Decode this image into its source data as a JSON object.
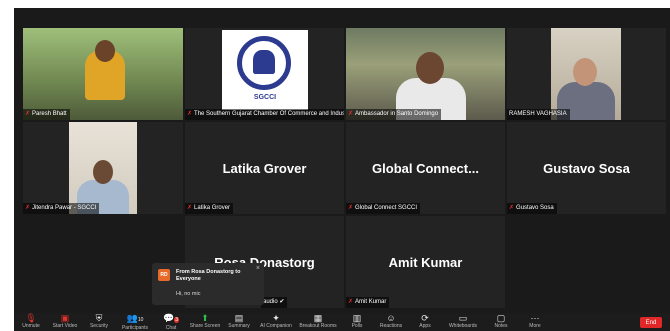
{
  "tiles": [
    {
      "label": "Paresh Bhatt"
    },
    {
      "label": "The Southern Gujarat Chamber Of Commerce and Industry",
      "logo_text": "SGCCI"
    },
    {
      "label": "Ambassador in Santo Domingo"
    },
    {
      "label": "RAMESH VAGHASIA"
    },
    {
      "label": "Jitendra Pawar - SGCCI"
    },
    {
      "label": "Latika Grover",
      "display": "Latika Grover"
    },
    {
      "label": "Global Connect SGCCI",
      "display": "Global  Connect..."
    },
    {
      "label": "Gustavo Sosa",
      "display": "Gustavo Sosa"
    },
    {
      "label": "audio ✔",
      "display": "Rosa Donastorg"
    },
    {
      "label": "Amit Kumar",
      "display": "Amit Kumar"
    }
  ],
  "chat": {
    "avatar": "RD",
    "from": "From Rosa Donastorg to Everyone",
    "message": "Hi, no mic",
    "close_icon": "close-icon"
  },
  "toolbar": {
    "participants_count": "10",
    "chat_badge": "3",
    "end_label": "End",
    "items": [
      {
        "icon": "mic-off-icon",
        "label": "Unmute"
      },
      {
        "icon": "video-off-icon",
        "label": "Start Video"
      },
      {
        "icon": "shield-icon",
        "label": "Security"
      },
      {
        "icon": "participants-icon",
        "label": "Participants"
      },
      {
        "icon": "chat-icon",
        "label": "Chat"
      },
      {
        "icon": "share-screen-icon",
        "label": "Share Screen"
      },
      {
        "icon": "summary-icon",
        "label": "Summary"
      },
      {
        "icon": "ai-companion-icon",
        "label": "AI Companion"
      },
      {
        "icon": "breakout-rooms-icon",
        "label": "Breakout Rooms"
      },
      {
        "icon": "polls-icon",
        "label": "Polls"
      },
      {
        "icon": "reactions-icon",
        "label": "Reactions"
      },
      {
        "icon": "apps-icon",
        "label": "Apps"
      },
      {
        "icon": "whiteboards-icon",
        "label": "Whiteboards"
      },
      {
        "icon": "notes-icon",
        "label": "Notes"
      },
      {
        "icon": "more-icon",
        "label": "More"
      }
    ]
  },
  "colors": {
    "active_speaker": "#d4d92a",
    "end_button": "#e02828",
    "mic_off": "#e0322b"
  }
}
